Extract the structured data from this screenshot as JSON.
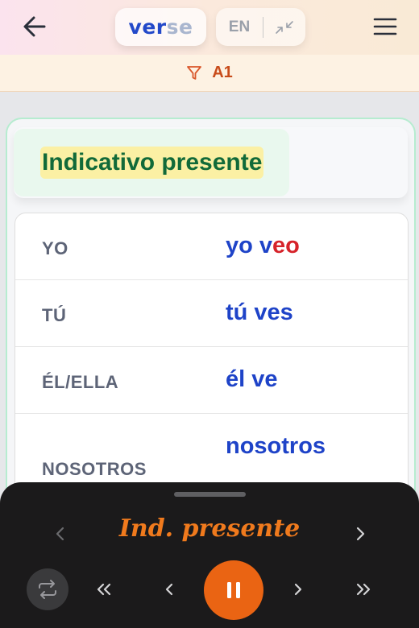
{
  "header": {
    "logo_part1": "ver",
    "logo_part2": "se",
    "language_code": "EN",
    "icons": {
      "back": "arrow-left-icon",
      "swap": "collapse-arrows-icon",
      "menu": "hamburger-menu-icon"
    }
  },
  "filter": {
    "icon": "filter-icon",
    "level": "A1"
  },
  "card": {
    "tense_title": "Indicativo presente",
    "rows": [
      {
        "pronoun": "YO",
        "stem": "yo v",
        "ending": "eo",
        "rest": ""
      },
      {
        "pronoun": "TÚ",
        "stem": "tú ves",
        "ending": "",
        "rest": ""
      },
      {
        "pronoun": "ÉL/ELLA",
        "stem": "él ve",
        "ending": "",
        "rest": ""
      },
      {
        "pronoun": "NOSOTROS",
        "stem": "nosotros",
        "ending": "",
        "rest": ""
      }
    ]
  },
  "player": {
    "title": "Ind. presente",
    "icons": {
      "prev_tense": "chevron-left-icon",
      "next_tense": "chevron-right-icon",
      "repeat": "repeat-icon",
      "rewind": "double-chevron-left-icon",
      "previous": "chevron-left-icon",
      "pause": "pause-icon",
      "next": "chevron-right-icon",
      "forward": "double-chevron-right-icon"
    }
  },
  "colors": {
    "accent_blue": "#1e43c8",
    "accent_orange": "#ea6413",
    "highlight_yellow": "#fbf0a4",
    "title_green": "#116a39",
    "ending_red": "#d6232a",
    "player_bg": "#1b1a1b"
  }
}
